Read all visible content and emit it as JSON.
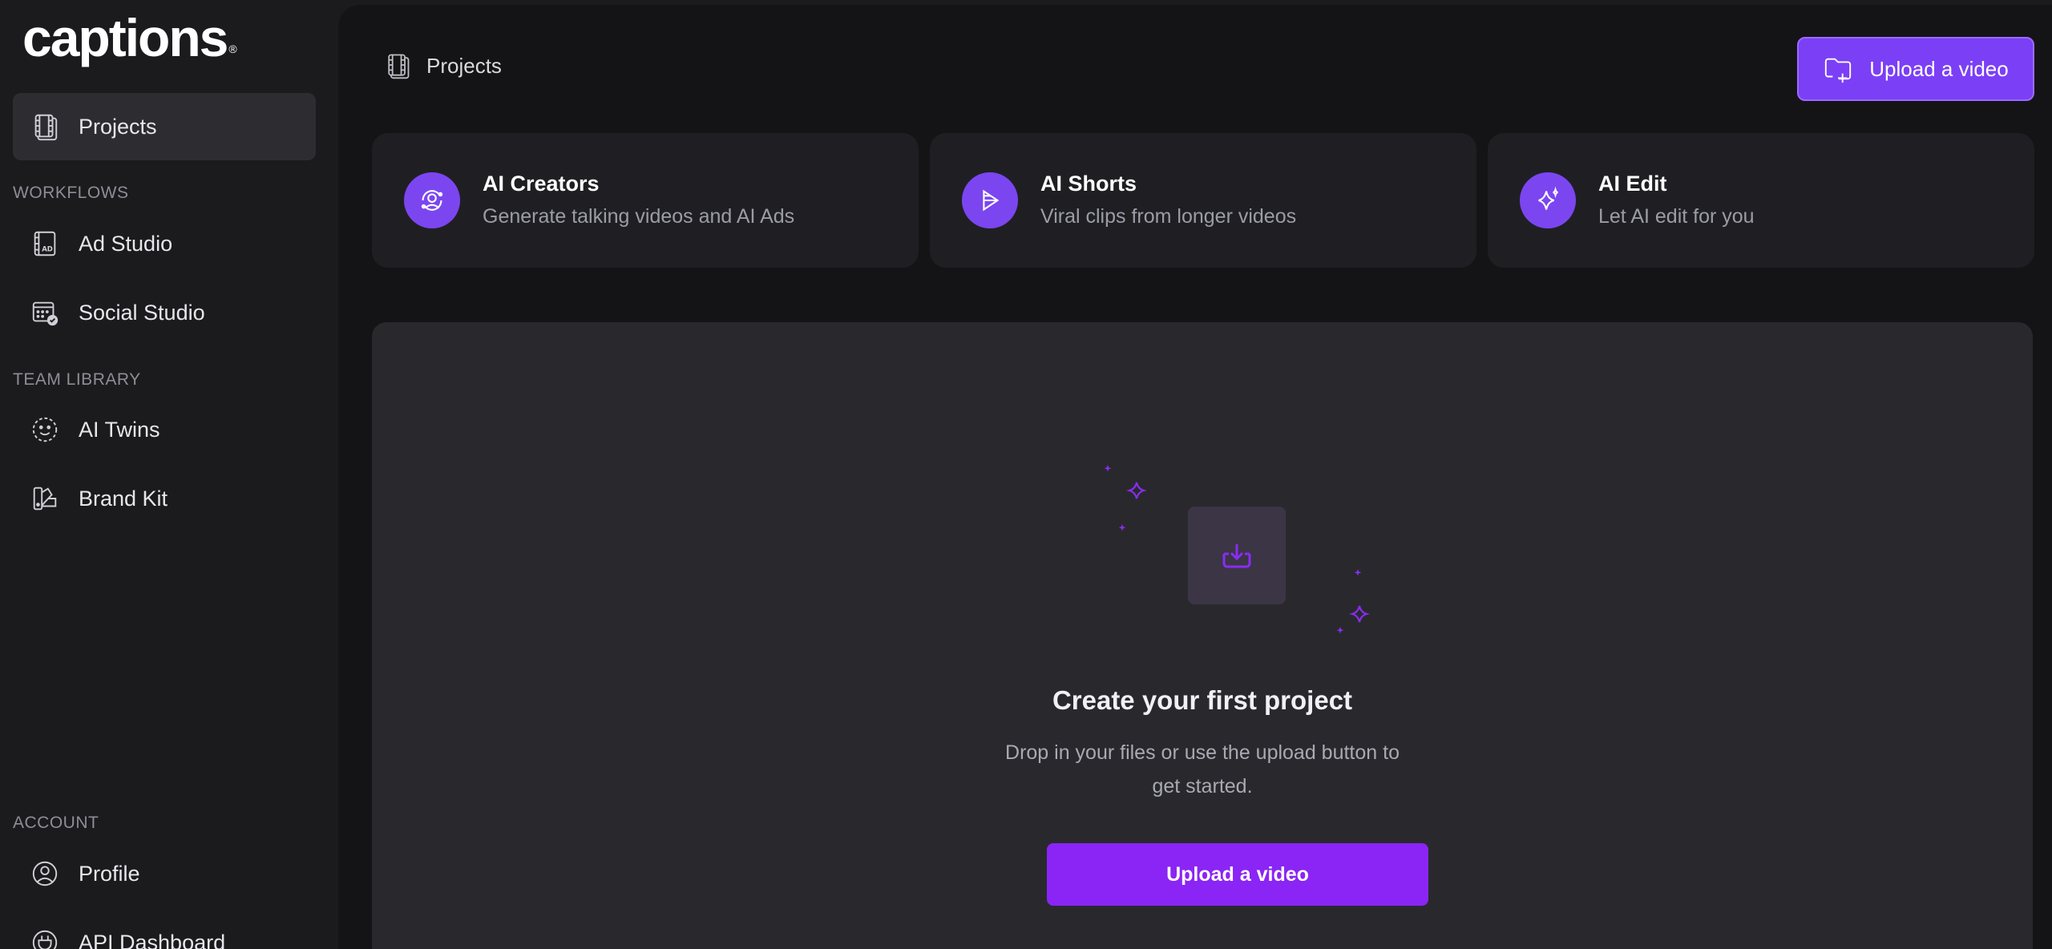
{
  "brand": {
    "logo": "captions",
    "logo_mark": "®"
  },
  "sidebar": {
    "active": {
      "label": "Projects",
      "icon": "film-stack-icon"
    },
    "workflows": {
      "title": "WORKFLOWS",
      "items": [
        {
          "label": "Ad Studio",
          "icon": "ad-studio-icon"
        },
        {
          "label": "Social Studio",
          "icon": "calendar-check-icon"
        }
      ]
    },
    "team_library": {
      "title": "TEAM LIBRARY",
      "items": [
        {
          "label": "AI Twins",
          "icon": "face-icon"
        },
        {
          "label": "Brand Kit",
          "icon": "palette-icon"
        }
      ]
    },
    "account": {
      "title": "ACCOUNT",
      "items": [
        {
          "label": "Profile",
          "icon": "user-circle-icon"
        },
        {
          "label": "API Dashboard",
          "icon": "plug-icon"
        }
      ]
    }
  },
  "header": {
    "breadcrumb": "Projects",
    "upload_label": "Upload a video"
  },
  "features": [
    {
      "title": "AI Creators",
      "desc": "Generate talking videos and AI Ads",
      "icon": "ai-creator-icon"
    },
    {
      "title": "AI Shorts",
      "desc": "Viral clips from longer videos",
      "icon": "play-icon"
    },
    {
      "title": "AI Edit",
      "desc": "Let AI edit for you",
      "icon": "sparkle-icon"
    }
  ],
  "empty_state": {
    "title": "Create your first project",
    "desc": "Drop in your files or use the upload button to get started.",
    "button_label": "Upload a video"
  },
  "colors": {
    "accent": "#8a25f5",
    "accent_soft": "#7b46f0",
    "sidebar_bg": "#1b1b1e",
    "main_bg": "#141417",
    "panel_bg": "#29292d"
  }
}
